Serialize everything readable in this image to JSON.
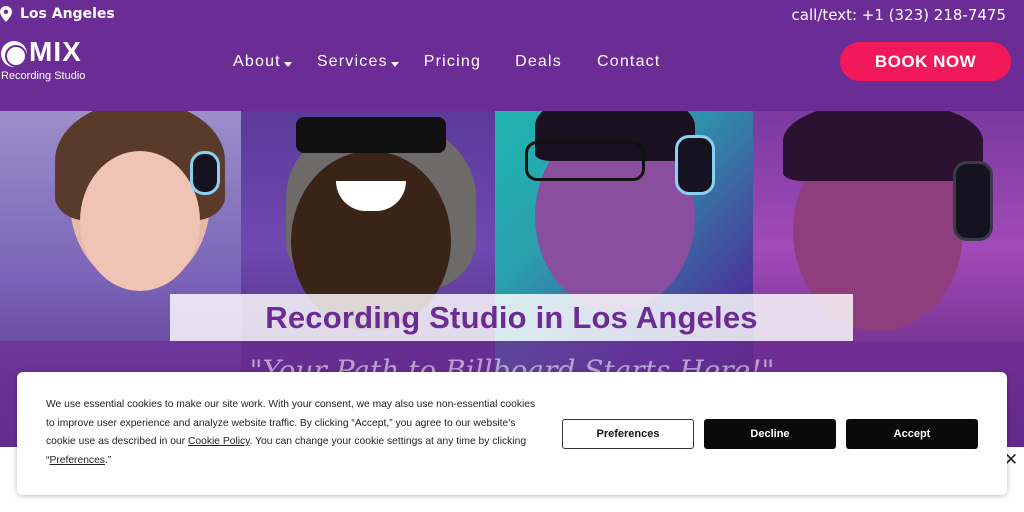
{
  "header": {
    "location": "Los Angeles",
    "phone": "call/text: +1 (323) 218-7475",
    "logo": {
      "name": "MIX",
      "subtitle": "Recording Studio"
    },
    "nav": [
      {
        "label": "About",
        "dropdown": true
      },
      {
        "label": "Services",
        "dropdown": true
      },
      {
        "label": "Pricing",
        "dropdown": false
      },
      {
        "label": "Deals",
        "dropdown": false
      },
      {
        "label": "Contact",
        "dropdown": false
      }
    ],
    "cta": "BOOK NOW"
  },
  "hero": {
    "title": "Recording Studio in Los Angeles",
    "tagline": "\"Your Path to Billboard Starts Here!\""
  },
  "cookie_banner": {
    "text_parts": [
      "We use essential cookies to make our site work. With your consent, we may also use non-essential cookies to improve user experience and analyze website traffic. By clicking “Accept,” you agree to our website's cookie use as described in our ",
      "Cookie Policy",
      ". You can change your cookie settings at any time by clicking “",
      "Preferences",
      ".”"
    ],
    "buttons": {
      "preferences": "Preferences",
      "decline": "Decline",
      "accept": "Accept"
    },
    "close": "✕"
  },
  "colors": {
    "brand_purple": "#6b2c95",
    "cta_pink": "#f2195b"
  },
  "icons": [
    "location-pin-icon",
    "logo-mark-icon",
    "chevron-down-icon",
    "close-icon"
  ]
}
